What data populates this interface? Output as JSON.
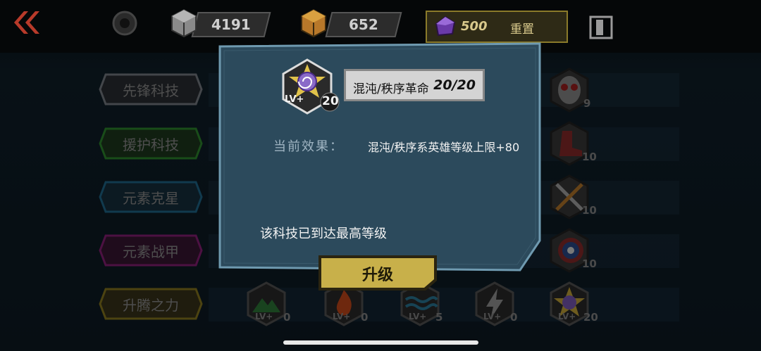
{
  "header": {
    "resource1": "4191",
    "resource2": "652",
    "gems": "500",
    "reset_label": "重置"
  },
  "sidebar": {
    "tabs": [
      {
        "label": "先锋科技",
        "color": "#7a8088"
      },
      {
        "label": "援护科技",
        "color": "#2f8a2f"
      },
      {
        "label": "元素克星",
        "color": "#1f6b8f"
      },
      {
        "label": "元素战甲",
        "color": "#8a1f78"
      },
      {
        "label": "升腾之力",
        "color": "#8a7a1f"
      }
    ]
  },
  "right_icons": [
    {
      "name": "skull-mask-icon",
      "level": "9"
    },
    {
      "name": "boot-icon",
      "level": "10"
    },
    {
      "name": "crossed-swords-icon",
      "level": "10"
    },
    {
      "name": "shield-icon",
      "level": "10"
    }
  ],
  "bottom_icons": [
    {
      "name": "mountain-icon",
      "level": "0"
    },
    {
      "name": "fire-icon",
      "level": "0"
    },
    {
      "name": "water-waves-icon",
      "level": "5"
    },
    {
      "name": "lightning-icon",
      "level": "0"
    },
    {
      "name": "spiral-star-icon",
      "level": "20"
    }
  ],
  "lv_plus": "LV+",
  "modal": {
    "badge_level": "20",
    "title": "混沌/秩序革命",
    "title_level": "20/20",
    "effect_label": "当前效果：",
    "effect_value": "混沌/秩序系英雄等级上限+80",
    "max_message": "该科技已到达最高等级",
    "upgrade_label": "升级"
  }
}
